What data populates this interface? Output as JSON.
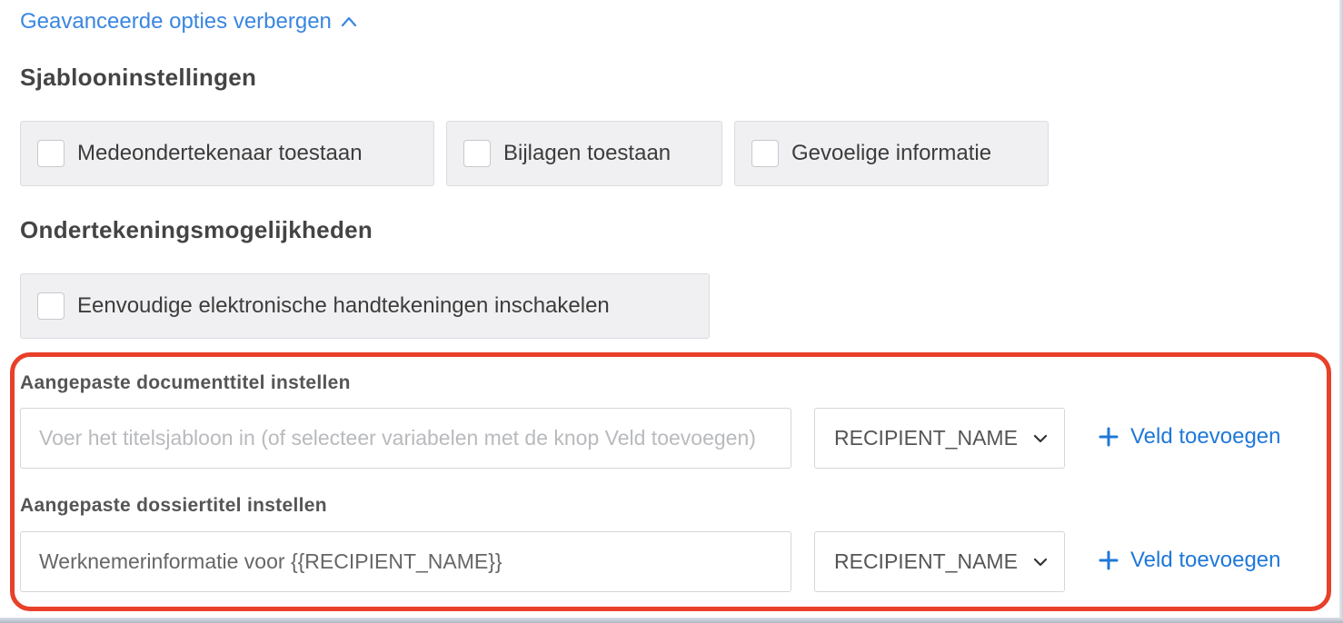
{
  "advanced_toggle": {
    "label": "Geavanceerde opties verbergen",
    "icon": "chevron-up-icon"
  },
  "template_settings": {
    "title": "Sjablooninstellingen",
    "options": [
      {
        "label": "Medeondertekenaar toestaan",
        "checked": false
      },
      {
        "label": "Bijlagen toestaan",
        "checked": false
      },
      {
        "label": "Gevoelige informatie",
        "checked": false
      }
    ]
  },
  "signing_options": {
    "title": "Ondertekeningsmogelijkheden",
    "options": [
      {
        "label": "Eenvoudige elektronische handtekeningen inschakelen",
        "checked": false
      }
    ]
  },
  "custom_document_title": {
    "label": "Aangepaste documenttitel instellen",
    "value": "",
    "placeholder": "Voer het titelsjabloon in (of selecteer variabelen met de knop Veld toevoegen)",
    "variable_select": "RECIPIENT_NAME",
    "add_field_label": "Veld toevoegen"
  },
  "custom_folder_title": {
    "label": "Aangepaste dossiertitel instellen",
    "value": "Werknemerinformatie voor {{RECIPIENT_NAME}}",
    "placeholder": "",
    "variable_select": "RECIPIENT_NAME",
    "add_field_label": "Veld toevoegen"
  },
  "colors": {
    "link": "#3a86e0",
    "accent": "#1f78d9",
    "highlight": "#e8402a",
    "checkbox_bg": "#f0f0f2"
  }
}
